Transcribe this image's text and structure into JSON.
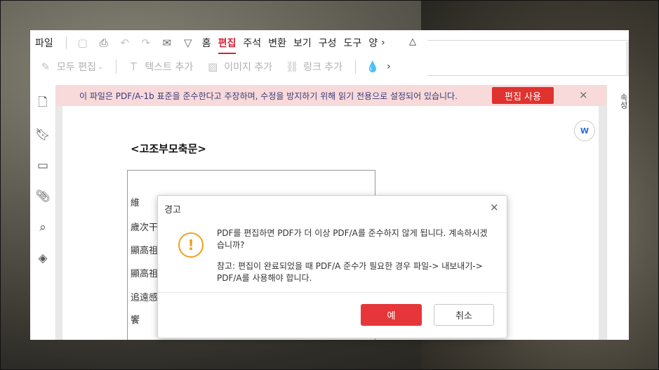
{
  "menu": {
    "file": "파일",
    "tabs": [
      "홈",
      "편집",
      "주석",
      "변환",
      "보기",
      "구성",
      "도구",
      "양"
    ],
    "active_tab": "편집",
    "more": "›"
  },
  "toolbar": {
    "edit_all": "모두 편집",
    "add_text": "텍스트 추가",
    "add_image": "이미지 추가",
    "add_link": "링크 추가"
  },
  "banner": {
    "message": "이 파일은 PDF/A-1b 표준을 준수한다고 주장하며, 수정을 방지하기 위해 읽기 전용으로 설정되어 있습니다.",
    "enable_edit": "편집 사용",
    "close": "×"
  },
  "document": {
    "title": "<고조부모축문>",
    "lines": [
      "維",
      "歲次干",
      "顯高祖",
      "顯高祖",
      "追遠感",
      "饗"
    ]
  },
  "right_panel": {
    "label": "속성"
  },
  "dialog": {
    "title": "경고",
    "close": "×",
    "message": "PDF를 편집하면 PDF가 더 이상 PDF/A를 준수하지 않게 됩니다. 계속하시겠습니까?",
    "note": "참고: 편집이 완료되었을 때 PDF/A 준수가 필요한 경우 파일-> 내보내기-> PDF/A를 사용해야 합니다.",
    "ok": "예",
    "cancel": "취소",
    "warn_symbol": "!"
  },
  "colors": {
    "accent": "#e0322f",
    "banner_bg": "#f8dada",
    "warning": "#f0a020"
  }
}
